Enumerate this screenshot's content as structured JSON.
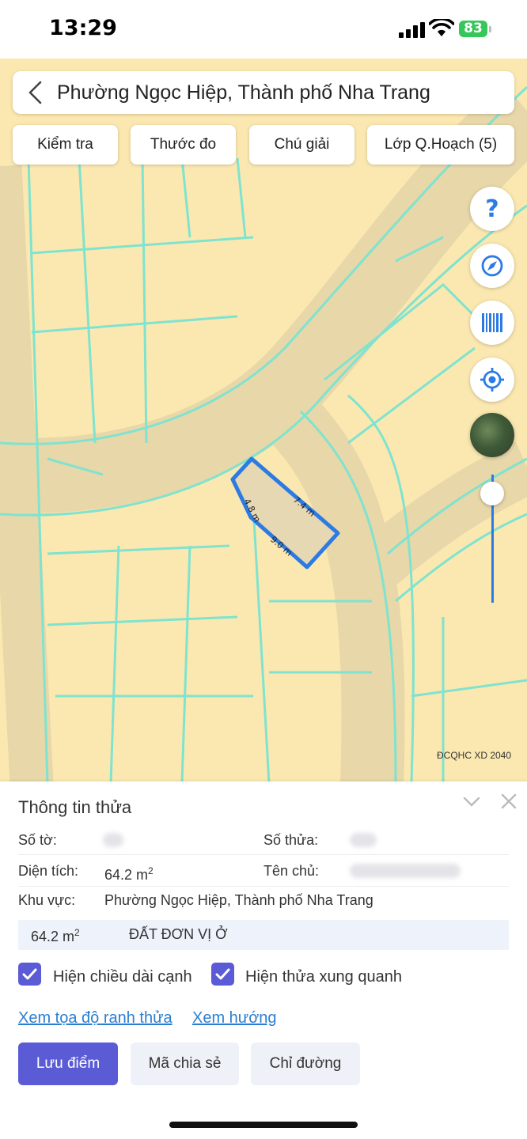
{
  "status_bar": {
    "time": "13:29",
    "battery": "83",
    "icons": [
      "signal-icon",
      "wifi-icon",
      "battery-icon"
    ]
  },
  "search": {
    "title": "Phường Ngọc Hiệp, Thành phố Nha Trang",
    "icon": "chevron-left-icon"
  },
  "toolbar": {
    "check": "Kiểm tra",
    "measure": "Thước đo",
    "legend": "Chú giải",
    "layers": "Lớp Q.Hoạch (5)"
  },
  "map_controls": {
    "help_icon": "question-icon",
    "compass_icon": "compass-icon",
    "barcode_icon": "barcode-icon",
    "locate_icon": "locate-icon",
    "satellite_icon": "satellite-icon",
    "zoom_level": 0.85
  },
  "map": {
    "source_label": "ĐCQHC XD 2040",
    "edge_labels": [
      "4.8 m",
      "7.4 m",
      "9.0 m"
    ],
    "colors": {
      "land": "#fbe8b0",
      "road": "#e7d7a9",
      "parcel_lines": "#7fe3cf",
      "selection": "#2c7be5"
    }
  },
  "panel": {
    "title": "Thông tin thửa",
    "sheet_label": "Số tờ:",
    "parcel_label": "Số thửa:",
    "area_label": "Diện tích:",
    "area_value": "64.2 m",
    "area_unit_sup": "2",
    "owner_label": "Tên chủ:",
    "region_label": "Khu vực:",
    "region_value": "Phường Ngọc Hiệp, Thành phố Nha Trang",
    "land_area": "64.2 m",
    "land_area_sup": "2",
    "land_type": "ĐẤT ĐƠN VỊ Ở",
    "show_edge_length": "Hiện chiều dài cạnh",
    "show_neighbors": "Hiện thửa xung quanh",
    "link_coords": "Xem tọa độ ranh thửa",
    "link_direction": "Xem hướng",
    "btn_save": "Lưu điểm",
    "btn_share": "Mã chia sẻ",
    "btn_directions": "Chỉ đường"
  }
}
